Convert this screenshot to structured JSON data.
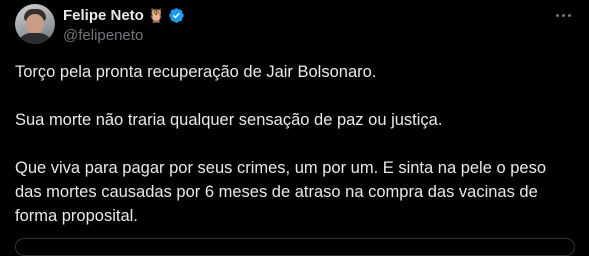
{
  "author": {
    "display_name": "Felipe Neto",
    "handle": "@felipeneto",
    "badge_icon": "owl-emoji-icon",
    "verified": true,
    "verified_color": "#1d9bf0"
  },
  "tweet": {
    "paragraphs": [
      "Torço pela pronta recuperação de Jair Bolsonaro.",
      "Sua morte não traria qualquer sensação de paz ou justiça.",
      "Que viva para pagar por seus crimes, um por um. E sinta na pele o peso das mortes causadas por 6 meses de atraso na compra das vacinas de forma proposital."
    ]
  },
  "colors": {
    "background": "#000000",
    "text_primary": "#e7e9ea",
    "text_secondary": "#71767b",
    "border": "#2f3336"
  }
}
